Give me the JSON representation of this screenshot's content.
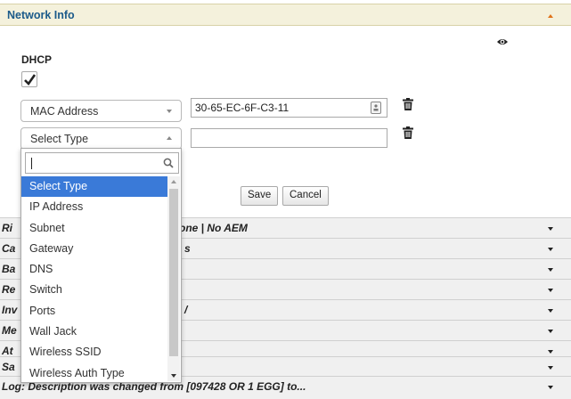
{
  "panel": {
    "title": "Network Info"
  },
  "dhcp": {
    "label": "DHCP",
    "checked": true
  },
  "row1": {
    "type": "MAC Address",
    "value": "30-65-EC-6F-C3-11"
  },
  "row2": {
    "type": "Select Type",
    "value": ""
  },
  "dropdown": {
    "search_value": "",
    "options": [
      "Select Type",
      "IP Address",
      "Subnet",
      "Gateway",
      "DNS",
      "Switch",
      "Ports",
      "Wall Jack",
      "Wireless SSID",
      "Wireless Auth Type"
    ],
    "selected": "Select Type"
  },
  "buttons": {
    "save": "Save",
    "cancel": "Cancel"
  },
  "collapsed_rows": [
    {
      "visible_prefix": "Ri",
      "visible_suffix": "t Done | No AEM"
    },
    {
      "visible_prefix": "Ca",
      "visible_suffix": "s"
    },
    {
      "visible_prefix": "Ba",
      "visible_suffix": ""
    },
    {
      "visible_prefix": "Re",
      "visible_suffix": ""
    },
    {
      "visible_prefix": "Inv",
      "visible_suffix": "/"
    },
    {
      "visible_prefix": "Me",
      "visible_suffix": ""
    },
    {
      "visible_prefix": "At",
      "visible_suffix": ""
    },
    {
      "visible_prefix": "Sa",
      "visible_suffix": ""
    },
    {
      "visible_prefix": "Log: Description was changed from [097428 OR 1 EGG] to...",
      "visible_suffix": ""
    }
  ],
  "colors": {
    "header_bg": "#f4f1dc",
    "title": "#1c5b8a",
    "accent": "#e0731a",
    "selected": "#3a7ad8"
  }
}
